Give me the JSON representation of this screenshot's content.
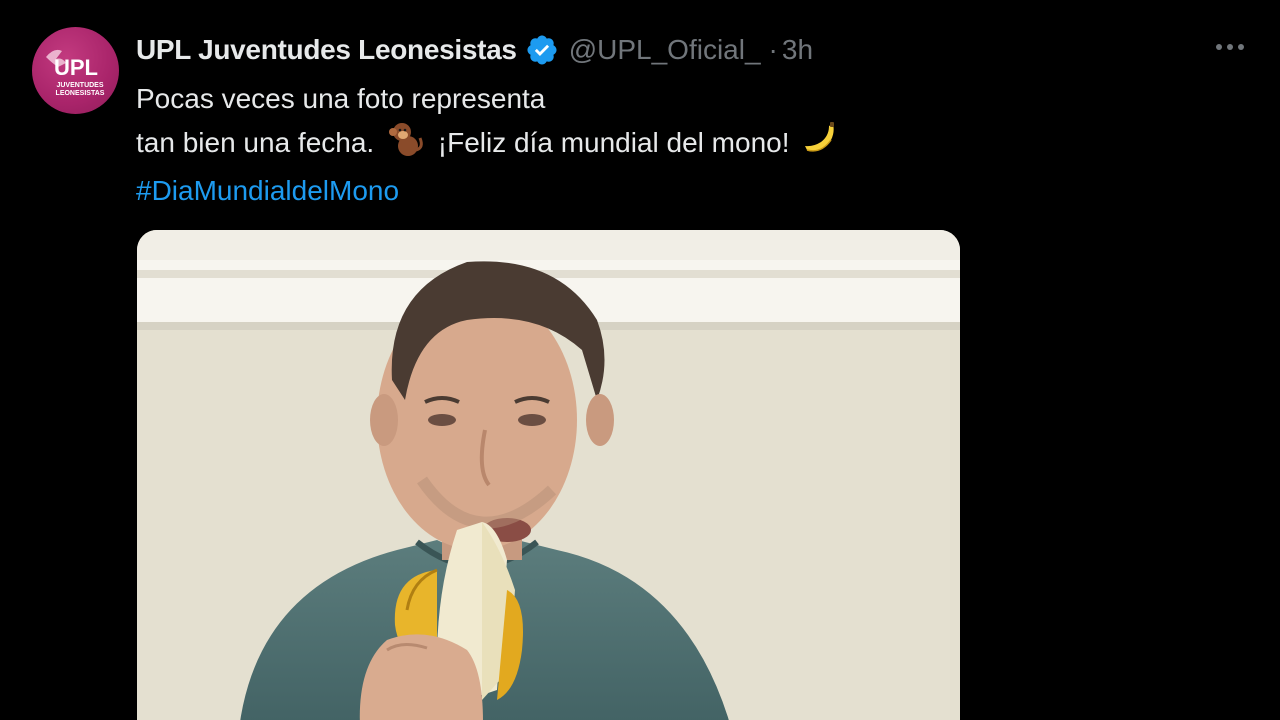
{
  "account": {
    "display_name": "UPL Juventudes Leonesistas",
    "handle": "@UPL_Oficial_",
    "separator": "·",
    "time": "3h",
    "avatar_logo_text": "UPL",
    "avatar_sub_1": "JUVENTUDES",
    "avatar_sub_2": "LEONESISTAS"
  },
  "post": {
    "line1": "Pocas veces una foto representa",
    "line2_a": "tan bien una fecha.",
    "line2_b": "¡Feliz día mundial del mono!",
    "hashtag": "#DiaMundialdelMono"
  },
  "icons": {
    "verified": "verified-badge-icon",
    "more": "more-horizontal-icon",
    "emoji_1": "monkey-emoji",
    "emoji_2": "banana-emoji"
  },
  "colors": {
    "background": "#000000",
    "text": "#e7e9ea",
    "secondary": "#71767b",
    "link": "#1d9bf0",
    "avatar": "#b02a6f"
  }
}
